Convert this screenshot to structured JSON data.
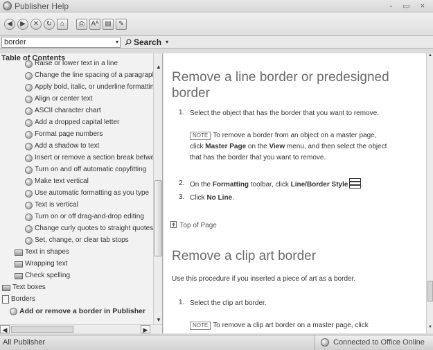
{
  "window": {
    "title": "Publisher Help",
    "controls": "- ▭ ×"
  },
  "toolbar": {
    "back": "◀",
    "forward": "▶",
    "stop": "✕",
    "refresh": "↻",
    "home": "⌂",
    "print": "⎙",
    "font_size": "Aᴬ",
    "toc_toggle": "▤",
    "pin": "✎"
  },
  "search": {
    "value": "border",
    "button_label": "Search",
    "dropdown_arrow": "▾"
  },
  "toc": {
    "header": "Table of Contents",
    "close": "×",
    "items": [
      {
        "label": "Raise or lower text in a line",
        "icon": "help",
        "bold": false
      },
      {
        "label": "Change the line spacing of a paragraph",
        "icon": "help",
        "bold": false
      },
      {
        "label": "Apply bold, italic, or underline formatting",
        "icon": "help",
        "bold": false
      },
      {
        "label": "Align or center text",
        "icon": "help",
        "bold": false
      },
      {
        "label": "ASCII character chart",
        "icon": "help",
        "bold": false
      },
      {
        "label": "Add a dropped capital letter",
        "icon": "help",
        "bold": false
      },
      {
        "label": "Format page numbers",
        "icon": "help",
        "bold": false
      },
      {
        "label": "Add a shadow to text",
        "icon": "help",
        "bold": false
      },
      {
        "label": "Insert or remove a section break between",
        "icon": "help",
        "bold": false
      },
      {
        "label": "Turn on and off automatic copyfitting",
        "icon": "help",
        "bold": false
      },
      {
        "label": "Make text vertical",
        "icon": "help",
        "bold": false
      },
      {
        "label": "Use automatic formatting as you type",
        "icon": "help",
        "bold": false
      },
      {
        "label": "Text is vertical",
        "icon": "help",
        "bold": false
      },
      {
        "label": "Turn on or off drag-and-drop editing",
        "icon": "help",
        "bold": false
      },
      {
        "label": "Change curly quotes to straight quotes",
        "icon": "help",
        "bold": false
      },
      {
        "label": "Set, change, or clear tab stops",
        "icon": "help",
        "bold": false
      },
      {
        "label": "Text in shapes",
        "icon": "book",
        "bold": false
      },
      {
        "label": "Wrapping text",
        "icon": "book",
        "bold": false
      },
      {
        "label": "Check spelling",
        "icon": "book",
        "bold": false
      },
      {
        "label": "Text boxes",
        "icon": "book",
        "bold": false
      },
      {
        "label": "Borders",
        "icon": "book-open",
        "bold": false
      },
      {
        "label": "Add or remove a border in Publisher",
        "icon": "help",
        "bold": true
      }
    ]
  },
  "scroll": {
    "up": "▲",
    "down": "▼",
    "left": "◀",
    "right": "▶"
  },
  "content": {
    "section1": {
      "title_line1": "Remove a line border or predesigned",
      "title_line2": "border",
      "step1_num": "1.",
      "step1": "Select the object that has the border that you want to remove.",
      "note_tag": "NOTE",
      "note_line1": "To remove a border from an object on a master page,",
      "note_line2_a": "click ",
      "note_line2_b": "Master Page",
      "note_line2_c": " on the ",
      "note_line2_d": "View",
      "note_line2_e": " menu, and then select the object",
      "note_line3": "that has the border that you want to remove.",
      "step2_num": "2.",
      "step2_a": "On the ",
      "step2_b": "Formatting",
      "step2_c": " toolbar, click ",
      "step2_d": "Line/Border Style",
      "step2_e": ".",
      "step3_num": "3.",
      "step3_a": "Click ",
      "step3_b": "No Line",
      "step3_c": "."
    },
    "top_of_page": "Top of Page",
    "section2": {
      "title": "Remove a clip art border",
      "intro": "Use this procedure if you inserted a piece of art as a border.",
      "step1_num": "1.",
      "step1": "Select the clip art border.",
      "note_tag": "NOTE",
      "note_line1": "To remove a clip art border on a master page, click"
    }
  },
  "status": {
    "scope": "All Publisher",
    "connection": "Connected to Office Online"
  }
}
